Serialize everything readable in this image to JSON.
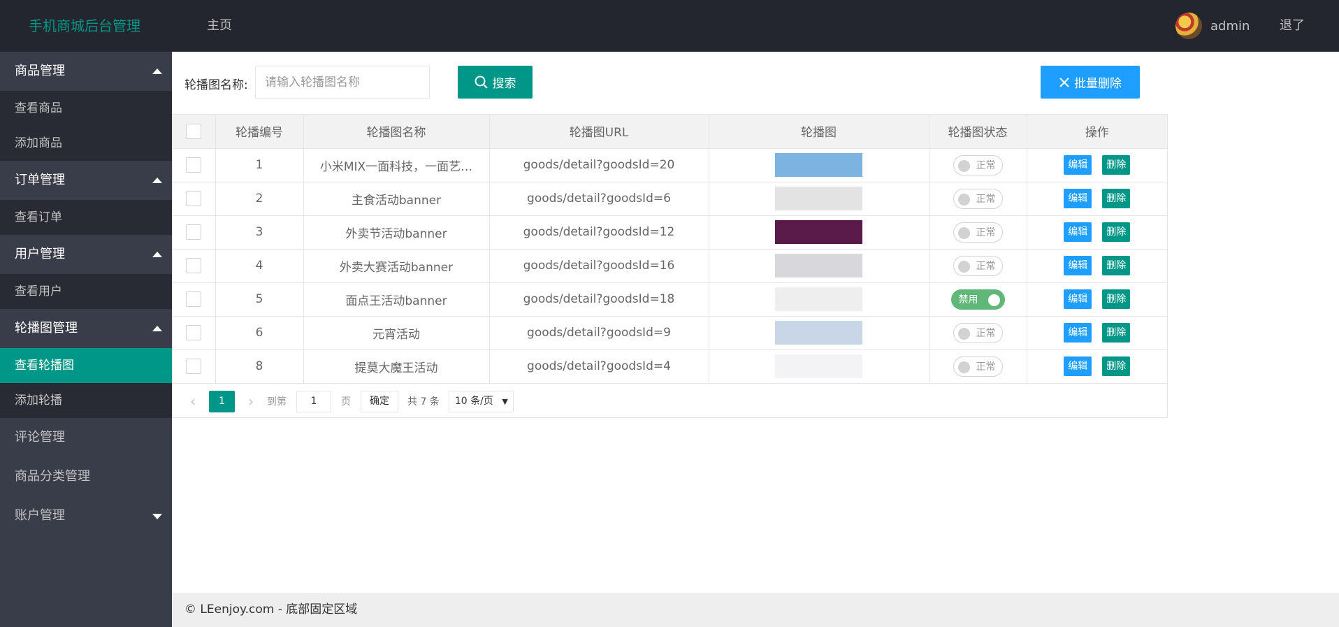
{
  "header": {
    "logo": "手机商城后台管理",
    "nav_home": "主页",
    "username": "admin",
    "logout": "退了"
  },
  "sidebar": {
    "groups": [
      {
        "label": "商品管理",
        "expanded": true,
        "items": [
          "查看商品",
          "添加商品"
        ]
      },
      {
        "label": "订单管理",
        "expanded": true,
        "items": [
          "查看订单"
        ]
      },
      {
        "label": "用户管理",
        "expanded": true,
        "items": [
          "查看用户"
        ]
      },
      {
        "label": "轮播图管理",
        "expanded": true,
        "items": [
          "查看轮播图",
          "添加轮播"
        ]
      }
    ],
    "active_item": "查看轮播图",
    "plain_items": [
      "评论管理",
      "商品分类管理"
    ],
    "account": {
      "label": "账户管理",
      "expanded": false
    }
  },
  "search": {
    "label": "轮播图名称:",
    "placeholder": "请输入轮播图名称",
    "button_label": "搜索",
    "batch_delete_label": "批量删除"
  },
  "table": {
    "columns": [
      "轮播编号",
      "轮播图名称",
      "轮播图URL",
      "轮播图",
      "轮播图状态",
      "操作"
    ],
    "rows": [
      {
        "id": "1",
        "name": "小米MIX一面科技，一面艺…",
        "url": "goods/detail?goodsId=20",
        "status": "正常",
        "enabled": true,
        "thumb_color": "#7db3e0"
      },
      {
        "id": "2",
        "name": "主食活动banner",
        "url": "goods/detail?goodsId=6",
        "status": "正常",
        "enabled": true,
        "thumb_color": "#e3e3e3"
      },
      {
        "id": "3",
        "name": "外卖节活动banner",
        "url": "goods/detail?goodsId=12",
        "status": "正常",
        "enabled": true,
        "thumb_color": "#5a1a4a"
      },
      {
        "id": "4",
        "name": "外卖大赛活动banner",
        "url": "goods/detail?goodsId=16",
        "status": "正常",
        "enabled": true,
        "thumb_color": "#d8d8dc"
      },
      {
        "id": "5",
        "name": "面点王活动banner",
        "url": "goods/detail?goodsId=18",
        "status": "禁用",
        "enabled": false,
        "thumb_color": "#eeeeee"
      },
      {
        "id": "6",
        "name": "元宵活动",
        "url": "goods/detail?goodsId=9",
        "status": "正常",
        "enabled": true,
        "thumb_color": "#c9d6e8"
      },
      {
        "id": "8",
        "name": "提莫大魔王活动",
        "url": "goods/detail?goodsId=4",
        "status": "正常",
        "enabled": true,
        "thumb_color": "#f3f3f5"
      }
    ],
    "edit_label": "编辑",
    "delete_label": "删除"
  },
  "pager": {
    "current": "1",
    "goto_label": "到第",
    "goto_value": "1",
    "page_unit": "页",
    "confirm": "确定",
    "total": "共 7 条",
    "page_size": "10 条/页"
  },
  "footer": {
    "brand": "© LEenjoy.com",
    "separator": " - ",
    "text": "底部固定区域"
  },
  "colors": {
    "header_bg": "#23262e",
    "sidebar_bg": "#393d49",
    "sidebar_sub_bg": "#282b33",
    "accent": "#009688",
    "blue": "#1e9fff",
    "switch_on": "#5fb878"
  }
}
